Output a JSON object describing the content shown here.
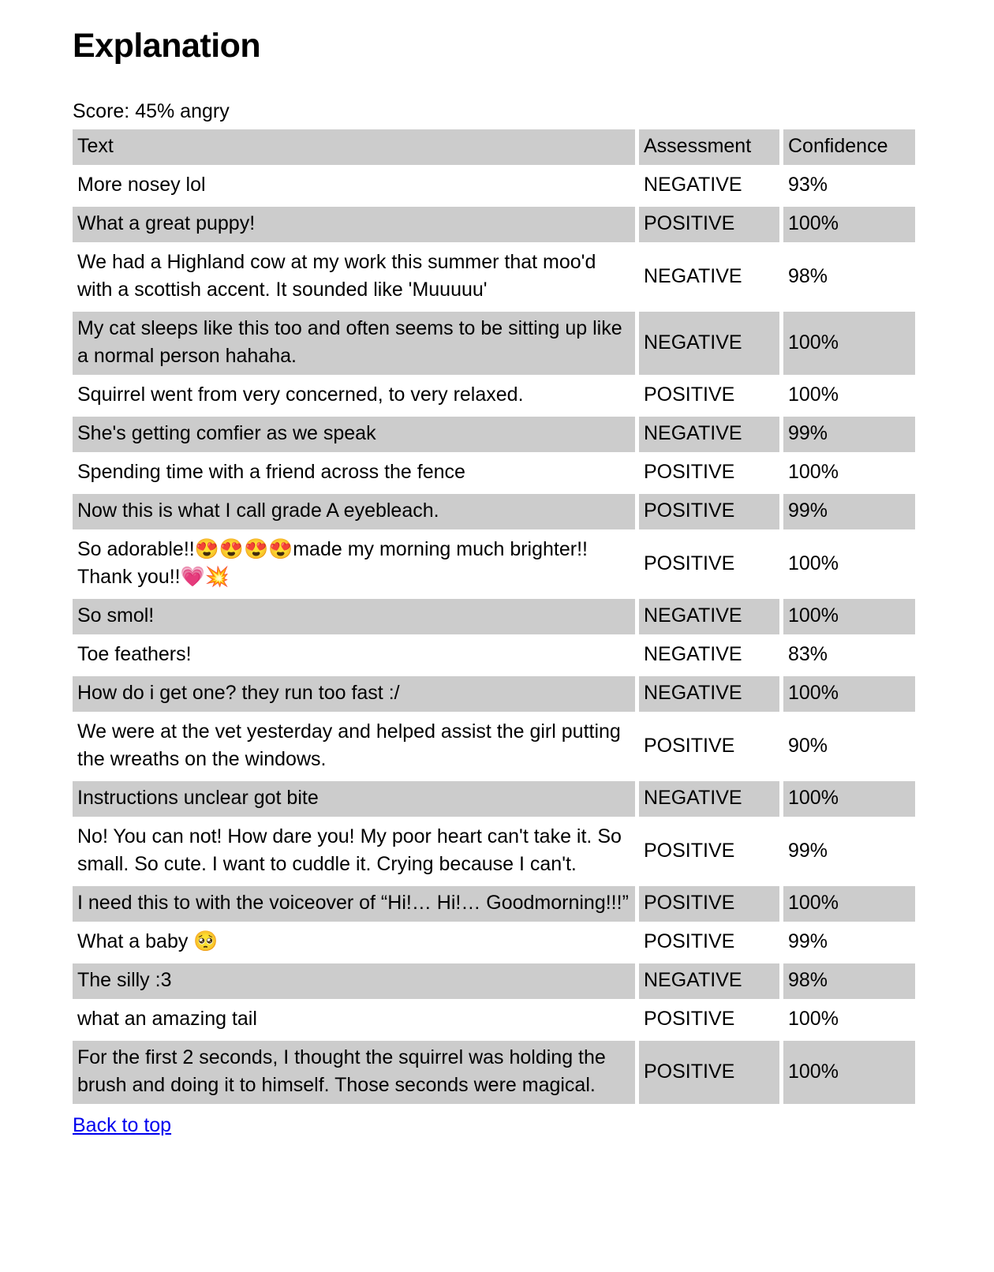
{
  "page": {
    "title": "Explanation",
    "score_label": "Score: 45% angry",
    "back_link": "Back to top",
    "shaded_row_color": "#cccccc",
    "link_color": "#0000ee",
    "background_color": "#ffffff"
  },
  "table": {
    "columns": [
      "Text",
      "Assessment",
      "Confidence"
    ],
    "rows": [
      {
        "text": "More nosey lol",
        "assessment": "NEGATIVE",
        "confidence": "93%"
      },
      {
        "text": "What a great puppy!",
        "assessment": "POSITIVE",
        "confidence": "100%"
      },
      {
        "text": "We had a Highland cow at my work this summer that moo'd with a scottish accent. It sounded like 'Muuuuu'",
        "assessment": "NEGATIVE",
        "confidence": "98%"
      },
      {
        "text": "My cat sleeps like this too and often seems to be sitting up like a normal person hahaha.",
        "assessment": "NEGATIVE",
        "confidence": "100%"
      },
      {
        "text": "Squirrel went from very concerned, to very relaxed.",
        "assessment": "POSITIVE",
        "confidence": "100%"
      },
      {
        "text": "She's getting comfier as we speak",
        "assessment": "NEGATIVE",
        "confidence": "99%"
      },
      {
        "text": "Spending time with a friend across the fence",
        "assessment": "POSITIVE",
        "confidence": "100%"
      },
      {
        "text": "Now this is what I call grade A eyebleach.",
        "assessment": "POSITIVE",
        "confidence": "99%"
      },
      {
        "text": "So adorable!!😍😍😍😍made my morning much brighter!! Thank you!!💗💥",
        "assessment": "POSITIVE",
        "confidence": "100%"
      },
      {
        "text": "So smol!",
        "assessment": "NEGATIVE",
        "confidence": "100%"
      },
      {
        "text": "Toe feathers!",
        "assessment": "NEGATIVE",
        "confidence": "83%"
      },
      {
        "text": "How do i get one? they run too fast :/",
        "assessment": "NEGATIVE",
        "confidence": "100%"
      },
      {
        "text": "We were at the vet yesterday and helped assist the girl putting the wreaths on the windows.",
        "assessment": "POSITIVE",
        "confidence": "90%"
      },
      {
        "text": "Instructions unclear got bite",
        "assessment": "NEGATIVE",
        "confidence": "100%"
      },
      {
        "text": "No! You can not! How dare you! My poor heart can't take it. So small. So cute. I want to cuddle it. Crying because I can't.",
        "assessment": "POSITIVE",
        "confidence": "99%"
      },
      {
        "text": "I need this to with the voiceover of “Hi!… Hi!… Goodmorning!!!”",
        "assessment": "POSITIVE",
        "confidence": "100%"
      },
      {
        "text": "What a baby 🥺",
        "assessment": "POSITIVE",
        "confidence": "99%"
      },
      {
        "text": "The silly :3",
        "assessment": "NEGATIVE",
        "confidence": "98%"
      },
      {
        "text": "what an amazing tail",
        "assessment": "POSITIVE",
        "confidence": "100%"
      },
      {
        "text": "For the first 2 seconds, I thought the squirrel was holding the brush and doing it to himself. Those seconds were magical.",
        "assessment": "POSITIVE",
        "confidence": "100%"
      }
    ]
  }
}
